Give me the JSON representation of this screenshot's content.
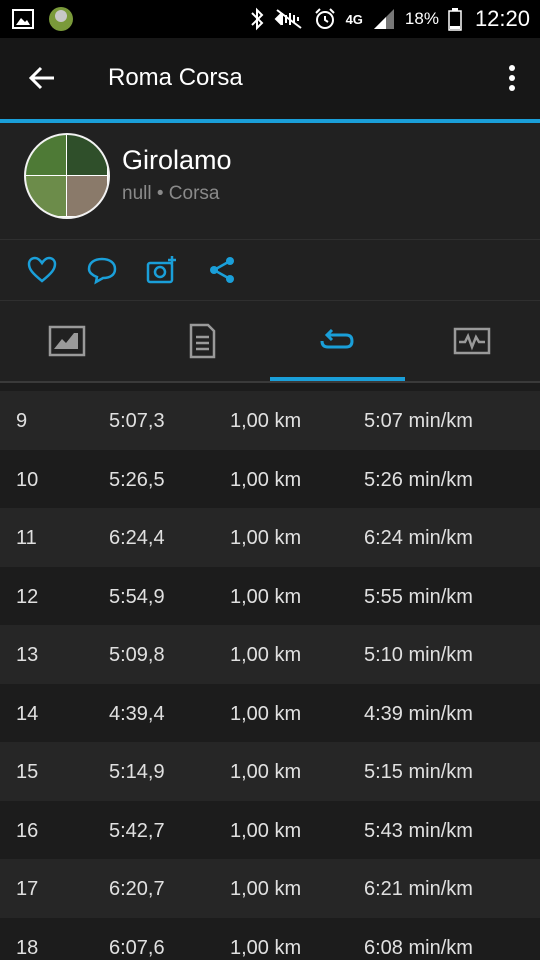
{
  "status_bar": {
    "network": "4G",
    "battery_percent": "18%",
    "time": "12:20"
  },
  "app_bar": {
    "title": "Roma Corsa"
  },
  "profile": {
    "name": "Girolamo",
    "subtitle": "null • Corsa"
  },
  "colors": {
    "accent": "#1a9fd9",
    "background": "#1c1c1c",
    "row_alt": "#262626"
  },
  "tabs": [
    {
      "icon": "chart-icon"
    },
    {
      "icon": "document-icon"
    },
    {
      "icon": "laps-icon",
      "active": true
    },
    {
      "icon": "activity-graph-icon"
    }
  ],
  "laps": [
    {
      "lap": "9",
      "time": "5:07,3",
      "distance": "1,00 km",
      "pace": "5:07 min/km"
    },
    {
      "lap": "10",
      "time": "5:26,5",
      "distance": "1,00 km",
      "pace": "5:26 min/km"
    },
    {
      "lap": "11",
      "time": "6:24,4",
      "distance": "1,00 km",
      "pace": "6:24 min/km"
    },
    {
      "lap": "12",
      "time": "5:54,9",
      "distance": "1,00 km",
      "pace": "5:55 min/km"
    },
    {
      "lap": "13",
      "time": "5:09,8",
      "distance": "1,00 km",
      "pace": "5:10 min/km"
    },
    {
      "lap": "14",
      "time": "4:39,4",
      "distance": "1,00 km",
      "pace": "4:39 min/km"
    },
    {
      "lap": "15",
      "time": "5:14,9",
      "distance": "1,00 km",
      "pace": "5:15 min/km"
    },
    {
      "lap": "16",
      "time": "5:42,7",
      "distance": "1,00 km",
      "pace": "5:43 min/km"
    },
    {
      "lap": "17",
      "time": "6:20,7",
      "distance": "1,00 km",
      "pace": "6:21 min/km"
    },
    {
      "lap": "18",
      "time": "6:07,6",
      "distance": "1,00 km",
      "pace": "6:08 min/km"
    }
  ]
}
